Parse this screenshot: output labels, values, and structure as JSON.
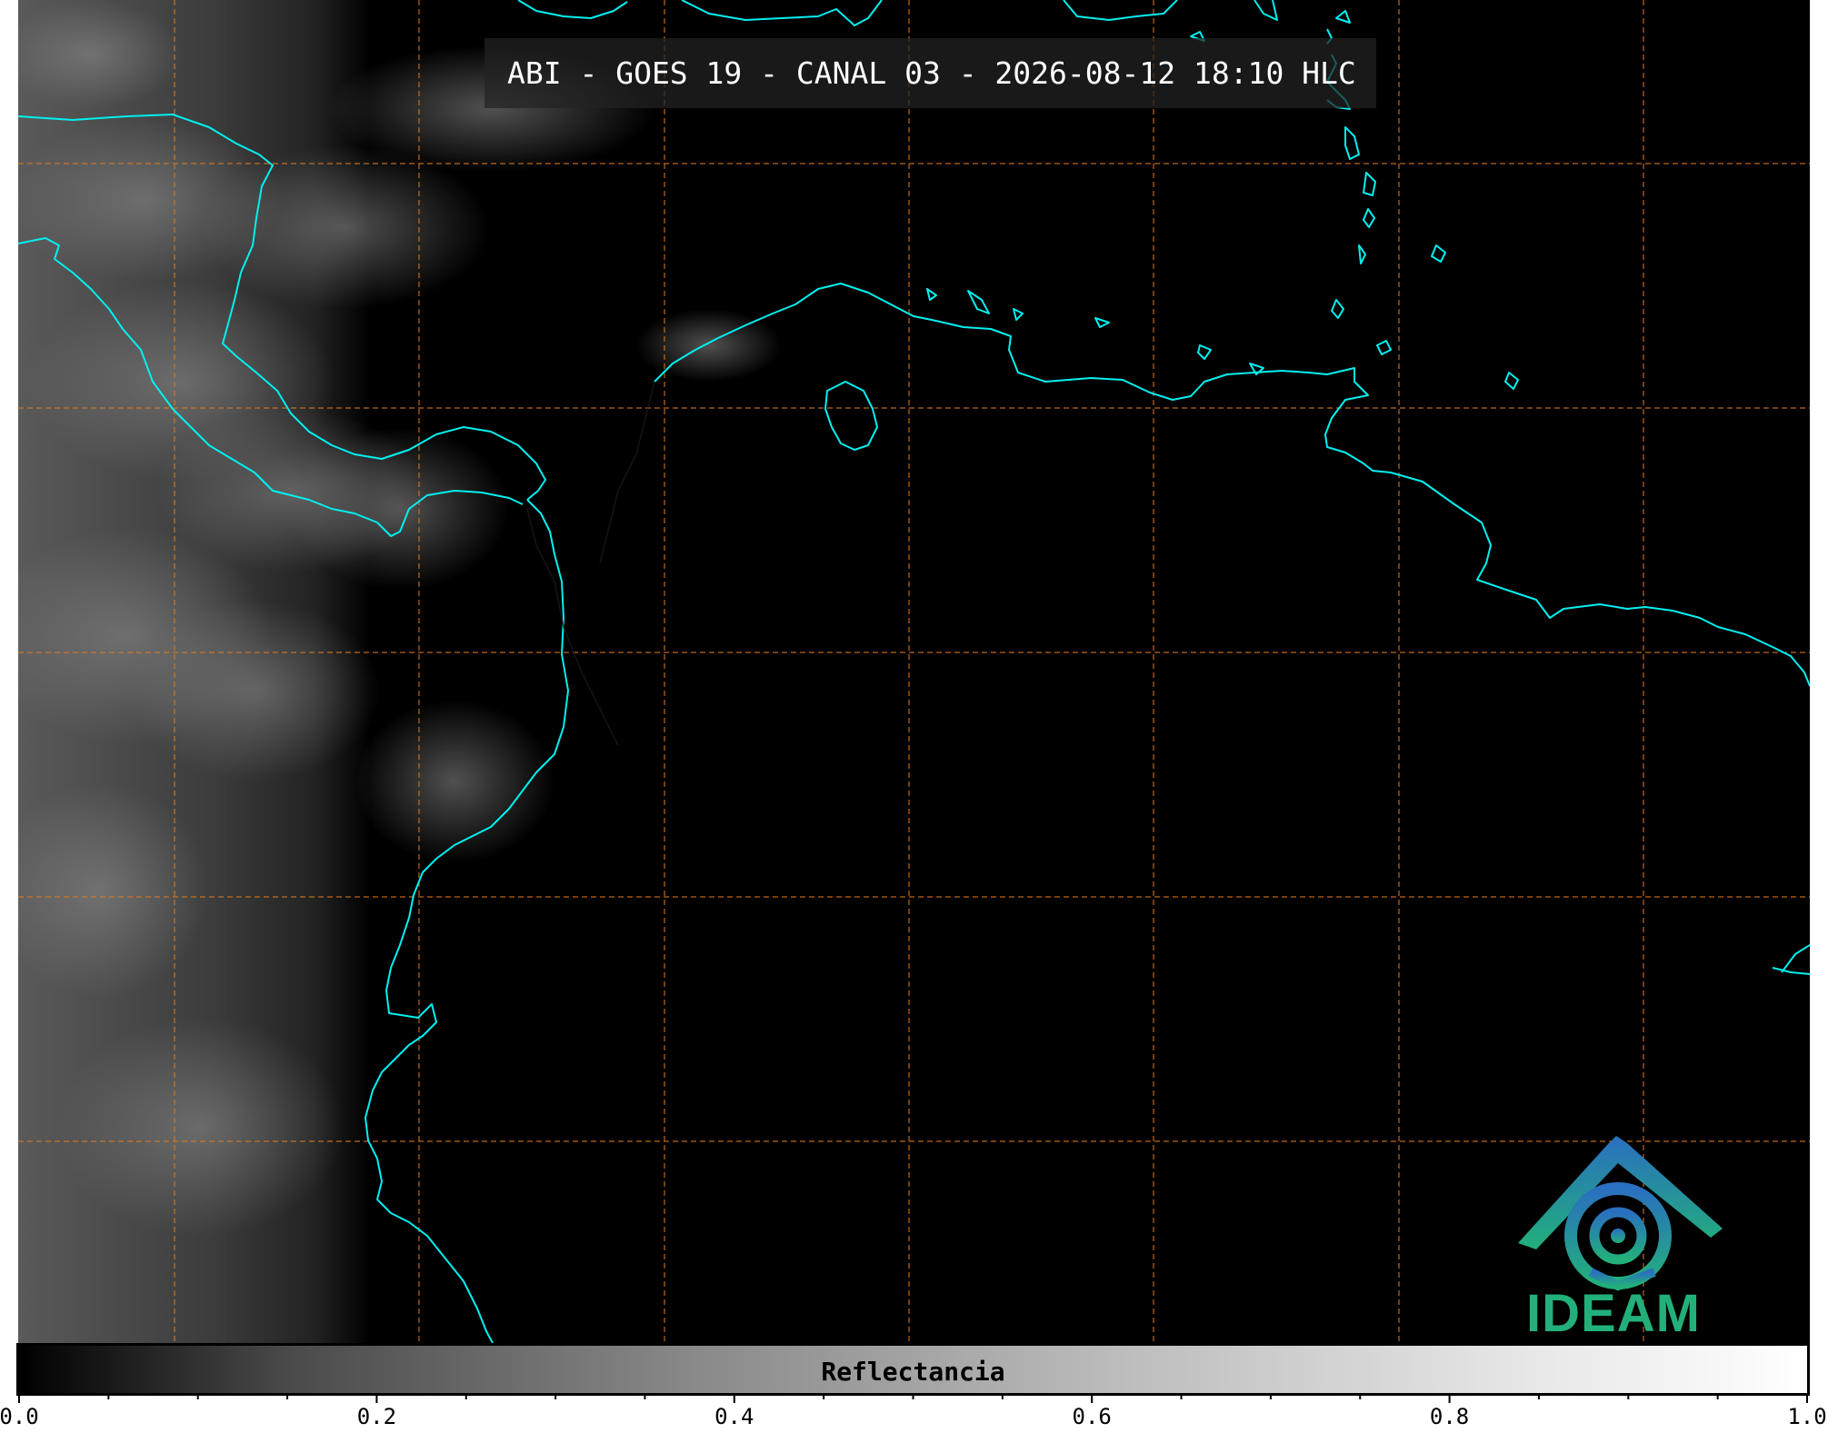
{
  "title": "ABI - GOES 19 - CANAL 03 - 2026-08-12 18:10 HLC",
  "colorbar": {
    "label": "Reflectancia",
    "ticks": [
      "0.0",
      "0.2",
      "0.4",
      "0.6",
      "0.8",
      "1.0"
    ]
  },
  "logo": {
    "text": "IDEAM"
  },
  "colors": {
    "coastline": "#00f0f0",
    "gridlines": "#e07a20",
    "background": "#000000",
    "logo_blue": "#2a7fc0",
    "logo_green": "#22b07a"
  }
}
